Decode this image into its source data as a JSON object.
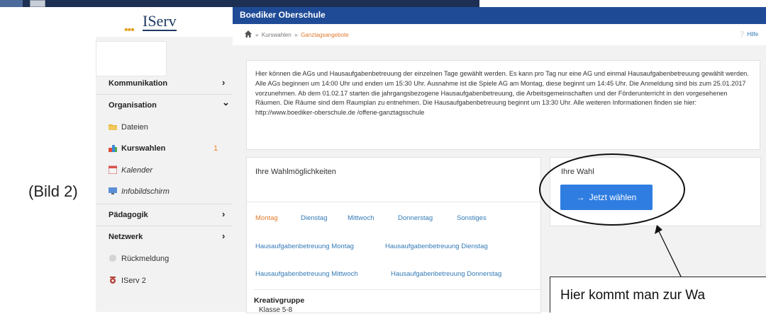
{
  "outer": {
    "figure_label": "(Bild 2)",
    "annotation_text": "Hier kommt man zur Wa"
  },
  "sidebar": {
    "logo": "IServ",
    "logo_dots": "•••",
    "items": [
      {
        "label": "Kommunikation",
        "chevron": "›"
      },
      {
        "label": "Organisation",
        "chevron": "⌄"
      },
      {
        "label": "Dateien",
        "icon": "folder-icon"
      },
      {
        "label": "Kurswahlen",
        "icon": "course-icon",
        "count": "1"
      },
      {
        "label": "Kalender",
        "icon": "calendar-icon"
      },
      {
        "label": "Infobildschirm",
        "icon": "screen-icon"
      },
      {
        "label": "Pädagogik",
        "chevron": "›"
      },
      {
        "label": "Netzwerk",
        "chevron": "›"
      },
      {
        "label": "Rückmeldung",
        "icon": "feedback-icon"
      },
      {
        "label": "IServ 2",
        "icon": "iserv-icon"
      }
    ]
  },
  "header": {
    "title": "Boediker Oberschule",
    "breadcrumb_sep": "»",
    "breadcrumb_1": "Kurswahlen",
    "breadcrumb_2": "Ganztagsangebote",
    "help": "Hilfe"
  },
  "info": {
    "text": "Hier können die AGs und Hausaufgabenbetreuung der einzelnen Tage gewählt werden. Es kann pro Tag nur eine AG und einmal Hausaufgabenbetreuung gewählt werden. Alle AGs beginnen um 14:00 Uhr und enden um 15:30 Uhr. Ausnahme ist die Spiele AG am Montag, diese beginnt um 14:45 Uhr. Die Anmeldung sind bis zum 25.01.2017 vorzunehmen. Ab dem 01.02.17 starten die jahrgangsbezogene Hausaufgabenbetreuung, die Arbeitsgemeinschaften und der Förderunterricht in den vorgesehenen Räumen. Die Räume sind dem Raumplan zu entnehmen. Die Hausaufgabenbetreuung beginnt um 13:30 Uhr. Alle weiteren Informationen finden sie hier: http://www.boediker-oberschule.de /offene-ganztagsschule"
  },
  "choices": {
    "title": "Ihre Wahlmöglichkeiten",
    "tabs": [
      "Montag",
      "Dienstag",
      "Mittwoch",
      "Donnerstag",
      "Sonstiges"
    ],
    "hw_links": [
      "Hausaufgabenbetreuung Montag",
      "Hausaufgabenbetreuung Dienstag",
      "Hausaufgabenbetreuung Mittwoch",
      "Hausaufgabenbetreuung Donnerstag"
    ],
    "group_title": "Kreativgruppe",
    "group_sub": "Klasse 5-8"
  },
  "selection": {
    "title": "Ihre Wahl",
    "button": "Jetzt wählen",
    "button_icon": "→"
  },
  "colors": {
    "header": "#1f4b96",
    "button": "#2f7de1",
    "link": "#337ab7",
    "active": "#e07a2e"
  }
}
